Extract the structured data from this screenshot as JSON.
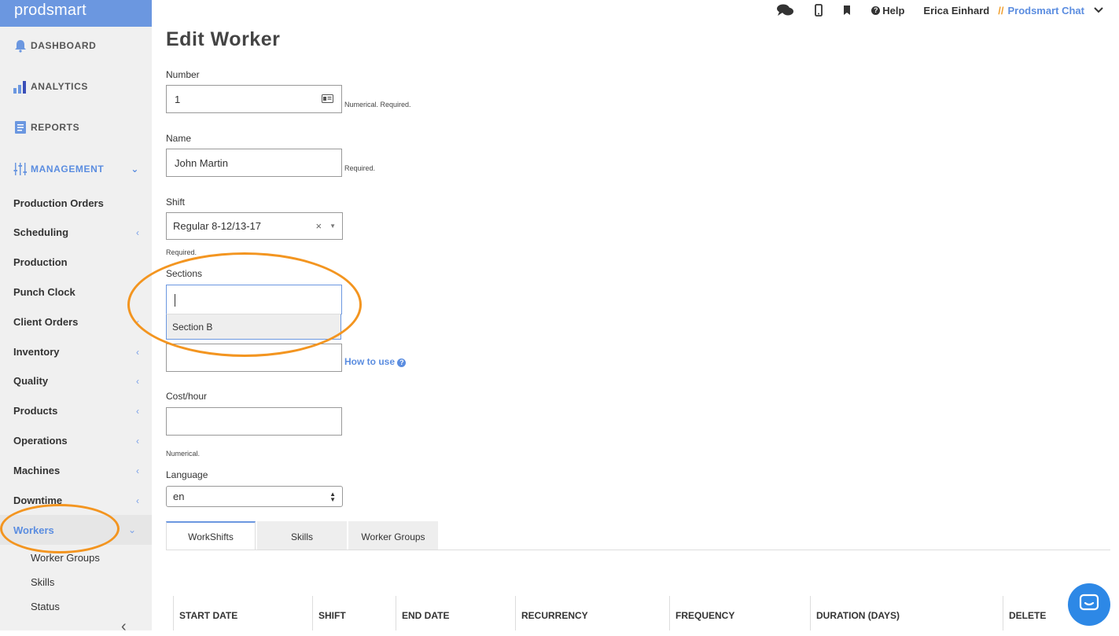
{
  "brand": "prodsmart",
  "main_nav": [
    {
      "label": "DASHBOARD",
      "icon": "bell-icon"
    },
    {
      "label": "ANALYTICS",
      "icon": "bar-chart-icon"
    },
    {
      "label": "REPORTS",
      "icon": "document-icon"
    },
    {
      "label": "MANAGEMENT",
      "icon": "sliders-icon"
    }
  ],
  "nav_items": [
    {
      "label": "Production Orders",
      "chevron": ""
    },
    {
      "label": "Scheduling",
      "chevron": "‹"
    },
    {
      "label": "Production",
      "chevron": ""
    },
    {
      "label": "Punch Clock",
      "chevron": ""
    },
    {
      "label": "Client Orders",
      "chevron": "‹"
    },
    {
      "label": "Inventory",
      "chevron": "‹"
    },
    {
      "label": "Quality",
      "chevron": "‹"
    },
    {
      "label": "Products",
      "chevron": "‹"
    },
    {
      "label": "Operations",
      "chevron": "‹"
    },
    {
      "label": "Machines",
      "chevron": "‹"
    },
    {
      "label": "Downtime",
      "chevron": "‹"
    },
    {
      "label": "Workers",
      "chevron": "⌄"
    }
  ],
  "sub_items": [
    "Worker Groups",
    "Skills",
    "Status"
  ],
  "topbar": {
    "help": "Help",
    "user": "Erica Einhard",
    "separator": "//",
    "chat": "Prodsmart Chat"
  },
  "page_title": "Edit Worker",
  "form": {
    "number_label": "Number",
    "number_value": "1",
    "number_hint": "Numerical. Required.",
    "name_label": "Name",
    "name_value": "John Martin",
    "name_hint": "Required.",
    "shift_label": "Shift",
    "shift_value": "Regular 8-12/13-17",
    "shift_hint": "Required.",
    "sections_label": "Sections",
    "sections_option": "Section B",
    "how_to_use": "How to use",
    "cost_label": "Cost/hour",
    "cost_hint": "Numerical.",
    "language_label": "Language",
    "language_value": "en"
  },
  "tabs": [
    "WorkShifts",
    "Skills",
    "Worker Groups"
  ],
  "table_headers": [
    "START DATE",
    "SHIFT",
    "END DATE",
    "RECURRENCY",
    "FREQUENCY",
    "DURATION (DAYS)",
    "DELETE"
  ],
  "colors": {
    "accent": "#5b8de0",
    "highlight": "#f39520",
    "brand_bar": "#6b97e0"
  }
}
